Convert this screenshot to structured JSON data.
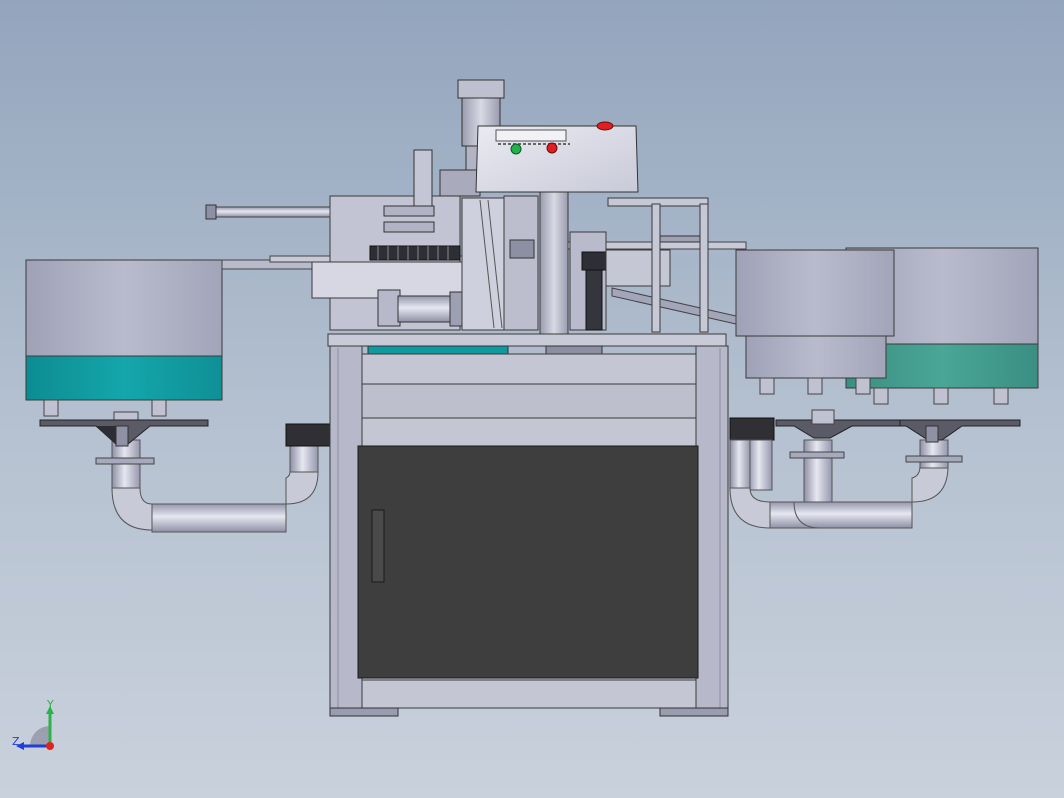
{
  "triad": {
    "y_label": "Y",
    "z_label": "Z",
    "y_color": "#2bb34a",
    "z_color": "#1f3fd6",
    "x_color": "#e0231e"
  },
  "colors": {
    "background_top": "#93a5bd",
    "background_bottom": "#c9d1dc",
    "frame": "#b5b8c8",
    "frame_edge": "#3a3a3a",
    "cabinet_door": "#3e3e3e",
    "bowl_body": "#a9abbf",
    "bowl_band_teal": "#0f9aa0",
    "bowl_band_green": "#3d9a8a",
    "pipe": "#c4c6d4",
    "stop_button": "#e02020",
    "start_button": "#22b14c"
  },
  "components": [
    "left-vibratory-bowl",
    "right-vibratory-bowl-front",
    "right-vibratory-bowl-rear",
    "control-panel",
    "air-cylinder",
    "machine-frame",
    "cabinet-door",
    "left-feed-pipe",
    "right-feed-pipe"
  ]
}
